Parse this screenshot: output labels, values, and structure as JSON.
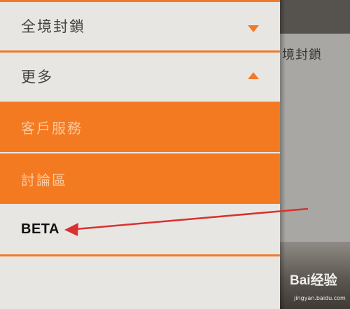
{
  "background_page": {
    "partial_text": "境封鎖"
  },
  "drawer": {
    "items": [
      {
        "label": "全境封鎖",
        "expanded": false
      },
      {
        "label": "更多",
        "expanded": true
      }
    ],
    "submenu": [
      {
        "label": "客戶服務"
      },
      {
        "label": "討論區"
      }
    ],
    "beta_label": "BETA"
  },
  "colors": {
    "accent": "#f47a22",
    "divider": "#f07a2c",
    "drawer_bg": "#e8e6e3",
    "annotation_arrow": "#d9312f"
  },
  "watermark": {
    "logo": "Bai经验",
    "url": "jingyan.baidu.com"
  }
}
